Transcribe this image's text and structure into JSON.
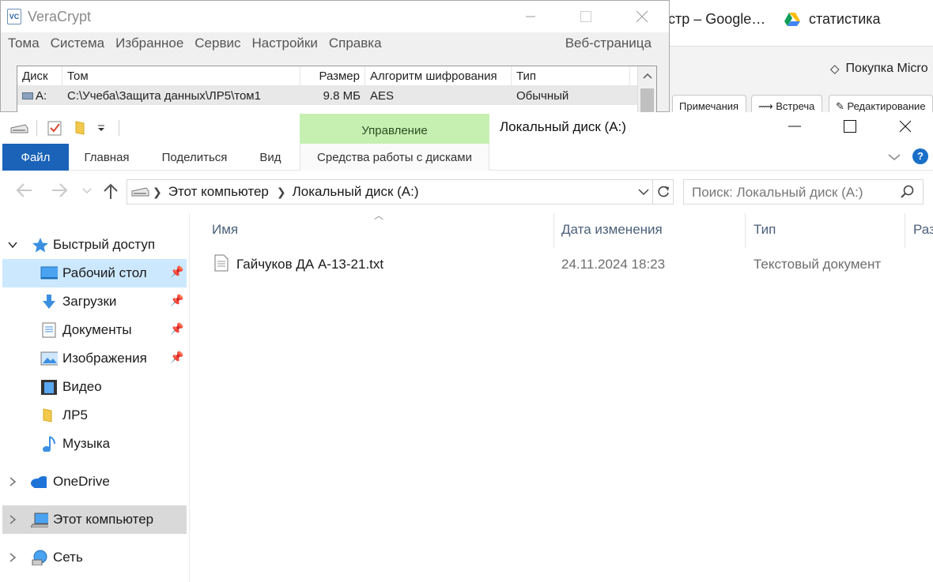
{
  "browser": {
    "tab1": "стр – Google…",
    "tab2": "статистика",
    "bookmark": "Покупка Micro",
    "pills": [
      "Примечания",
      "Встреча",
      "Редактирование"
    ]
  },
  "veracrypt": {
    "title": "VeraCrypt",
    "logo": "VC",
    "menu": [
      "Тома",
      "Система",
      "Избранное",
      "Сервис",
      "Настройки",
      "Справка"
    ],
    "webpage": "Веб-страница",
    "columns": [
      "Диск",
      "Том",
      "Размер",
      "Алгоритм шифрования",
      "Тип"
    ],
    "row": {
      "drive": "A:",
      "volume": "C:\\Учеба\\Защита данных\\ЛР5\\том1",
      "size": "9.8 МБ",
      "algorithm": "AES",
      "type": "Обычный"
    }
  },
  "explorer": {
    "title": "Локальный диск (A:)",
    "manage_tab": "Управление",
    "ribbon_tabs": {
      "file": "Файл",
      "home": "Главная",
      "share": "Поделиться",
      "view": "Вид",
      "tools": "Средства работы с дисками"
    },
    "help": "?",
    "address": [
      "Этот компьютер",
      "Локальный диск (A:)"
    ],
    "search_placeholder": "Поиск: Локальный диск (A:)",
    "nav": {
      "quick_access": "Быстрый доступ",
      "desktop": "Рабочий стол",
      "downloads": "Загрузки",
      "documents": "Документы",
      "pictures": "Изображения",
      "videos": "Видео",
      "lr5": "ЛР5",
      "music": "Музыка",
      "onedrive": "OneDrive",
      "this_pc": "Этот компьютер",
      "network": "Сеть"
    },
    "columns": {
      "name": "Имя",
      "date": "Дата изменения",
      "type": "Тип",
      "size": "Раз"
    },
    "files": [
      {
        "name": "Гайчуков ДА А-13-21.txt",
        "date": "24.11.2024 18:23",
        "type": "Текстовый документ"
      }
    ]
  }
}
